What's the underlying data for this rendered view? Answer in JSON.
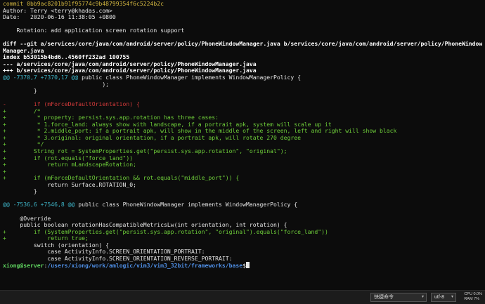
{
  "terminal": {
    "lines": [
      {
        "type": "commit",
        "text": "commit 0bb9ac8201b91f95774c9b48799354f6c5224b2c"
      },
      {
        "type": "normal",
        "text": "Author: Terry <terry@khadas.com>"
      },
      {
        "type": "normal",
        "text": "Date:   2020-06-16 11:38:05 +0800"
      },
      {
        "type": "normal",
        "text": ""
      },
      {
        "type": "normal",
        "text": "    Rotation: add application screen rotation support"
      },
      {
        "type": "normal",
        "text": ""
      },
      {
        "type": "bold",
        "text": "diff --git a/services/core/java/com/android/server/policy/PhoneWindowManager.java b/services/core/java/com/android/server/policy/PhoneWindow"
      },
      {
        "type": "bold",
        "text": "Manager.java"
      },
      {
        "type": "bold",
        "text": "index b53015b4bd6..4560ff232ad 100755"
      },
      {
        "type": "bold",
        "text": "--- a/services/core/java/com/android/server/policy/PhoneWindowManager.java"
      },
      {
        "type": "bold",
        "text": "+++ b/services/core/java/com/android/server/policy/PhoneWindowManager.java"
      },
      {
        "type": "hunk",
        "text": "@@ -7370,7 +7370,17 @@",
        "rest": " public class PhoneWindowManager implements WindowManagerPolicy {"
      },
      {
        "type": "normal",
        "text": "                             );"
      },
      {
        "type": "normal",
        "text": "         }"
      },
      {
        "type": "normal",
        "text": ""
      },
      {
        "type": "del",
        "text": "-        if (mForceDefaultOrientation) {"
      },
      {
        "type": "add",
        "text": "+        /*"
      },
      {
        "type": "add",
        "text": "+         * property: persist.sys.app.rotation has three cases:"
      },
      {
        "type": "add",
        "text": "+         * 1.force_land: always show with landscape, if a portrait apk, system will scale up it"
      },
      {
        "type": "add",
        "text": "+         * 2.middle_port: if a portrait apk, will show in the middle of the screen, left and right will show black"
      },
      {
        "type": "add",
        "text": "+         * 3.original: original orientation, if a portrait apk, will rotate 270 degree"
      },
      {
        "type": "add",
        "text": "+         */"
      },
      {
        "type": "add",
        "text": "+        String rot = SystemProperties.get(\"persist.sys.app.rotation\", \"original\");"
      },
      {
        "type": "add",
        "text": "+        if (rot.equals(\"force_land\"))"
      },
      {
        "type": "add",
        "text": "+            return mLandscapeRotation;"
      },
      {
        "type": "add",
        "text": "+"
      },
      {
        "type": "add",
        "text": "+        if (mForceDefaultOrientation && rot.equals(\"middle_port\")) {"
      },
      {
        "type": "normal",
        "text": "             return Surface.ROTATION_0;"
      },
      {
        "type": "normal",
        "text": "         }"
      },
      {
        "type": "normal",
        "text": ""
      },
      {
        "type": "hunk",
        "text": "@@ -7536,6 +7546,8 @@",
        "rest": " public class PhoneWindowManager implements WindowManagerPolicy {"
      },
      {
        "type": "normal",
        "text": ""
      },
      {
        "type": "normal",
        "text": "     @Override"
      },
      {
        "type": "normal",
        "text": "     public boolean rotationHasCompatibleMetricsLw(int orientation, int rotation) {"
      },
      {
        "type": "add",
        "text": "+        if (SystemProperties.get(\"persist.sys.app.rotation\", \"original\").equals(\"force_land\"))"
      },
      {
        "type": "add",
        "text": "+            return true;"
      },
      {
        "type": "normal",
        "text": "         switch (orientation) {"
      },
      {
        "type": "normal",
        "text": "             case ActivityInfo.SCREEN_ORIENTATION_PORTRAIT:"
      },
      {
        "type": "normal",
        "text": "             case ActivityInfo.SCREEN_ORIENTATION_REVERSE_PORTRAIT:"
      }
    ],
    "prompt": {
      "user": "xiong@server",
      "sep": ":",
      "path": "/users/xiong/work/amlogic/vim3/vim3_32bit/frameworks/base",
      "symbol": "$"
    }
  },
  "taskbar": {
    "shortcut_label": "快捷命令",
    "encoding_label": "utf-8",
    "cpu_text": "CPU 0.0%",
    "ram_text": "RAM 7%"
  }
}
